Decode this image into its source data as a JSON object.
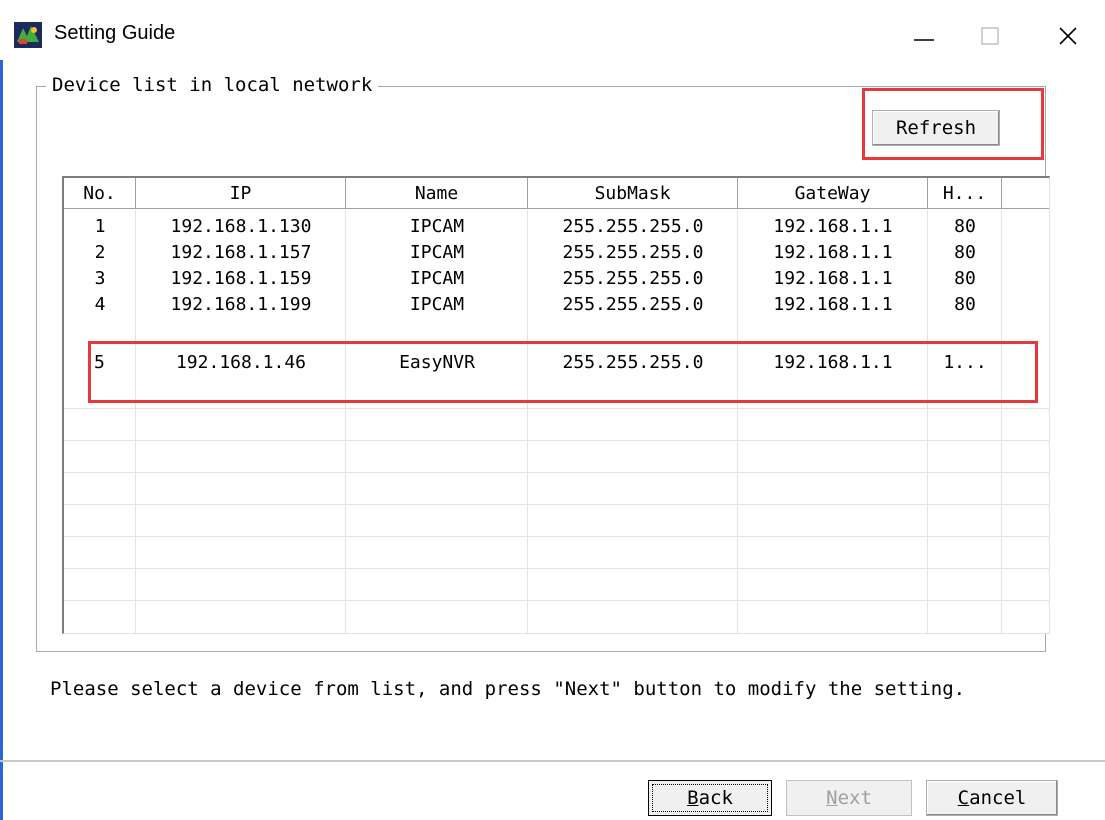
{
  "window": {
    "title": "Setting Guide",
    "icons": {
      "app": "app-icon",
      "minimize": "minimize-icon",
      "maximize": "maximize-icon",
      "close": "close-icon"
    }
  },
  "group": {
    "label": "Device list in local network",
    "refresh_label": "Refresh"
  },
  "table": {
    "columns": [
      "No.",
      "IP",
      "Name",
      "SubMask",
      "GateWay",
      "H..."
    ],
    "rows": [
      [
        "1",
        "192.168.1.130",
        "IPCAM",
        "255.255.255.0",
        "192.168.1.1",
        "80"
      ],
      [
        "2",
        "192.168.1.157",
        "IPCAM",
        "255.255.255.0",
        "192.168.1.1",
        "80"
      ],
      [
        "3",
        "192.168.1.159",
        "IPCAM",
        "255.255.255.0",
        "192.168.1.1",
        "80"
      ],
      [
        "4",
        "192.168.1.199",
        "IPCAM",
        "255.255.255.0",
        "192.168.1.1",
        "80"
      ],
      [
        "5",
        "192.168.1.46",
        "EasyNVR",
        "255.255.255.0",
        "192.168.1.1",
        "1..."
      ]
    ]
  },
  "instruction": "Please select a device from list, and press \"Next\" button to modify the setting.",
  "buttons": {
    "back": {
      "hotkey": "B",
      "rest": "ack"
    },
    "next": {
      "hotkey": "N",
      "rest": "ext"
    },
    "cancel": {
      "hotkey": "C",
      "rest": "ancel"
    }
  },
  "colors": {
    "highlight": "#e8383d",
    "disabled_text": "#a0a0a0"
  }
}
